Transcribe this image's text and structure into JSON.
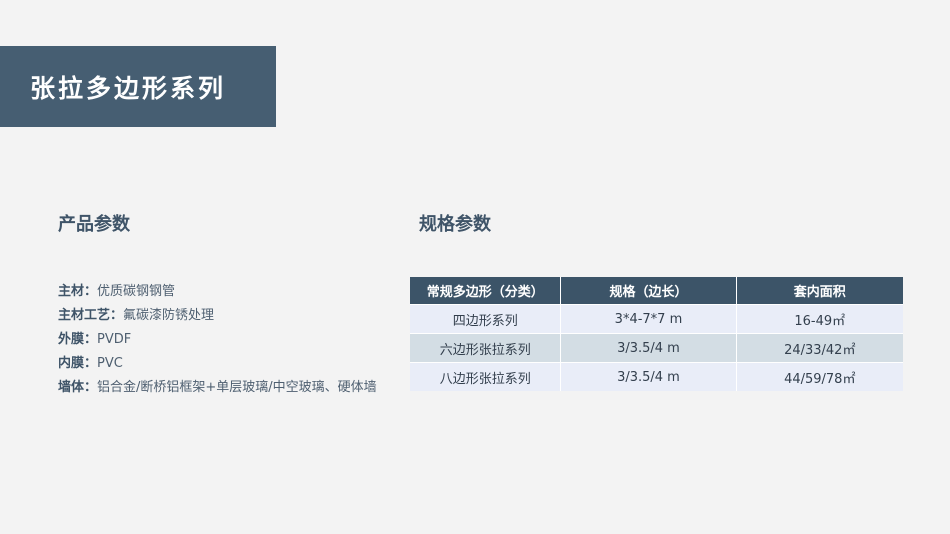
{
  "title": "张拉多边形系列",
  "product_section": {
    "heading": "产品参数",
    "params": [
      {
        "label": "主材：",
        "value": "优质碳钢钢管"
      },
      {
        "label": "主材工艺：",
        "value": "氟碳漆防锈处理"
      },
      {
        "label": "外膜：",
        "value": "PVDF"
      },
      {
        "label": "内膜：",
        "value": "PVC"
      },
      {
        "label": "墙体：",
        "value": "铝合金/断桥铝框架+单层玻璃/中空玻璃、硬体墙"
      }
    ]
  },
  "spec_section": {
    "heading": "规格参数",
    "table": {
      "headers": [
        "常规多边形（分类）",
        "规格（边长）",
        "套内面积"
      ],
      "rows": [
        [
          "四边形系列",
          "3*4-7*7 m",
          "16-49㎡"
        ],
        [
          "六边形张拉系列",
          "3/3.5/4 m",
          "24/33/42㎡"
        ],
        [
          "八边形张拉系列",
          "3/3.5/4 m",
          "44/59/78㎡"
        ]
      ]
    }
  },
  "colors": {
    "banner": "#465e72",
    "table_header": "#3c5468",
    "row_light": "#e9edf8",
    "row_dark": "#d3dde4"
  }
}
